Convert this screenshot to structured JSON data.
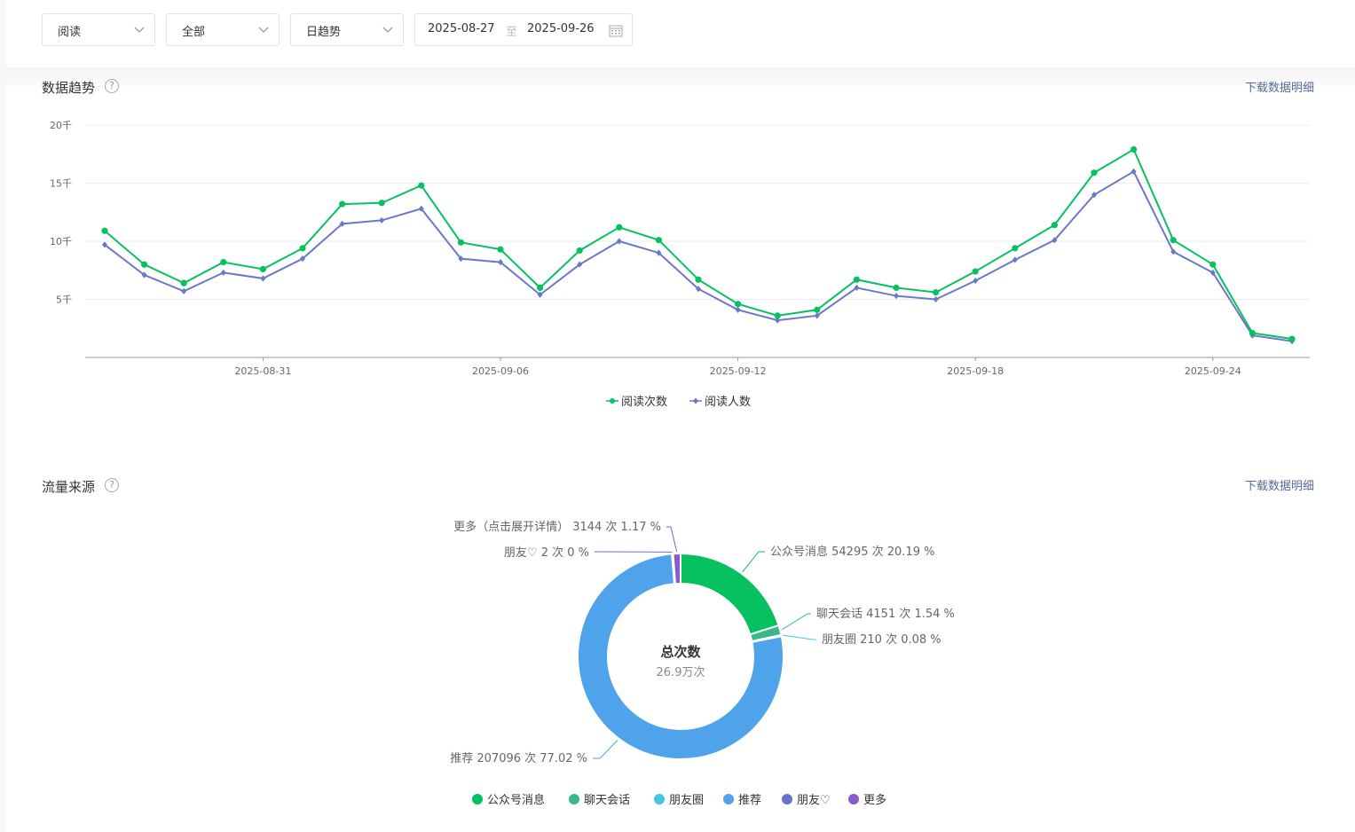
{
  "filters": {
    "metric": "阅读",
    "scope": "全部",
    "granularity": "日趋势",
    "date_start": "2025-08-27",
    "date_separator": "至",
    "date_end": "2025-09-26"
  },
  "trend": {
    "title": "数据趋势",
    "help": "?",
    "download": "下载数据明细"
  },
  "source": {
    "title": "流量来源",
    "help": "?",
    "download": "下载数据明细",
    "center_title": "总次数",
    "center_value": "26.9万次"
  },
  "chart_data": [
    {
      "type": "line",
      "x": [
        "2025-08-27",
        "2025-08-28",
        "2025-08-29",
        "2025-08-30",
        "2025-08-31",
        "2025-09-01",
        "2025-09-02",
        "2025-09-03",
        "2025-09-04",
        "2025-09-05",
        "2025-09-06",
        "2025-09-07",
        "2025-09-08",
        "2025-09-09",
        "2025-09-10",
        "2025-09-11",
        "2025-09-12",
        "2025-09-13",
        "2025-09-14",
        "2025-09-15",
        "2025-09-16",
        "2025-09-17",
        "2025-09-18",
        "2025-09-19",
        "2025-09-20",
        "2025-09-21",
        "2025-09-22",
        "2025-09-23",
        "2025-09-24",
        "2025-09-25",
        "2025-09-26"
      ],
      "x_tick_labels": [
        "2025-08-31",
        "2025-09-06",
        "2025-09-12",
        "2025-09-18",
        "2025-09-24"
      ],
      "y_tick_labels": [
        "5千",
        "10千",
        "15千",
        "20千"
      ],
      "ylim": [
        0,
        20000
      ],
      "grid": true,
      "legend_position": "bottom",
      "series": [
        {
          "name": "阅读次数",
          "color": "#07c160",
          "marker": "circle",
          "values": [
            10900,
            8000,
            6400,
            8200,
            7600,
            9400,
            13200,
            13300,
            14800,
            9900,
            9300,
            6000,
            9200,
            11200,
            10100,
            6700,
            4600,
            3600,
            4100,
            6700,
            6000,
            5600,
            7400,
            9400,
            11400,
            15900,
            17900,
            10100,
            8000,
            2100,
            1600
          ]
        },
        {
          "name": "阅读人数",
          "color": "#6b78c8",
          "marker": "diamond",
          "values": [
            9700,
            7100,
            5700,
            7300,
            6800,
            8500,
            11500,
            11800,
            12800,
            8500,
            8200,
            5400,
            8000,
            10000,
            9000,
            5900,
            4100,
            3200,
            3600,
            6000,
            5300,
            5000,
            6600,
            8400,
            10100,
            14000,
            16000,
            9100,
            7300,
            1900,
            1400
          ]
        }
      ]
    },
    {
      "type": "pie",
      "title": "",
      "slices": [
        {
          "label": "公众号消息",
          "callout": "公众号消息 54295 次 20.19 %",
          "value": 54295,
          "percent": 20.19,
          "color": "#07c160"
        },
        {
          "label": "聊天会话",
          "callout": "聊天会话 4151 次 1.54 %",
          "value": 4151,
          "percent": 1.54,
          "color": "#39b88a"
        },
        {
          "label": "朋友圈",
          "callout": "朋友圈 210 次 0.08 %",
          "value": 210,
          "percent": 0.08,
          "color": "#3fc8e0"
        },
        {
          "label": "推荐",
          "callout": "推荐 207096 次 77.02 %",
          "value": 207096,
          "percent": 77.02,
          "color": "#4ea3ea"
        },
        {
          "label": "朋友♡",
          "callout": "朋友♡ 2 次 0 %",
          "value": 2,
          "percent": 0,
          "color": "#6772d0"
        },
        {
          "label": "更多",
          "callout": "更多（点击展开详情） 3144 次 1.17 %",
          "value": 3144,
          "percent": 1.17,
          "color": "#8a5bd0"
        }
      ],
      "legend_position": "bottom"
    }
  ]
}
